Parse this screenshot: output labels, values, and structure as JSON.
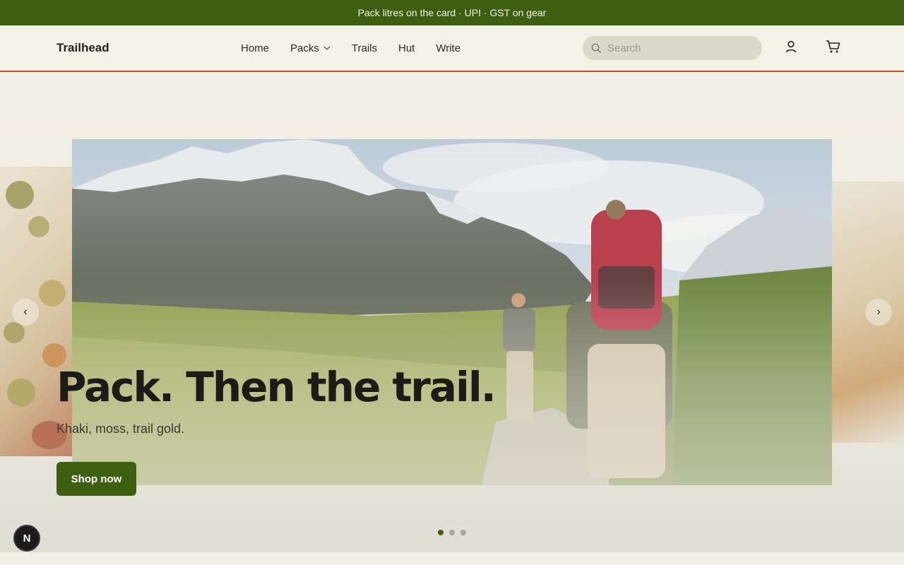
{
  "announcement": {
    "text": "Pack litres on the card · UPI · GST on gear"
  },
  "header": {
    "brand": "Trailhead",
    "nav": [
      {
        "label": "Home"
      },
      {
        "label": "Packs",
        "has_dropdown": true
      },
      {
        "label": "Trails"
      },
      {
        "label": "Hut"
      },
      {
        "label": "Write"
      }
    ],
    "search": {
      "placeholder": "Search",
      "icon": "search-icon"
    },
    "icons": [
      "user-icon",
      "cart-icon"
    ]
  },
  "hero": {
    "headline": "Pack. Then the trail.",
    "subline": "Khaki, moss, trail gold.",
    "cta_label": "Shop now",
    "prev_glyph": "‹",
    "next_glyph": "›",
    "slide_count": 3,
    "active_slide": 1
  },
  "dev_badge": {
    "label": "N"
  },
  "colors": {
    "accent": "#3c5f12",
    "header_border": "#b4551f",
    "background": "#f2efe4"
  }
}
